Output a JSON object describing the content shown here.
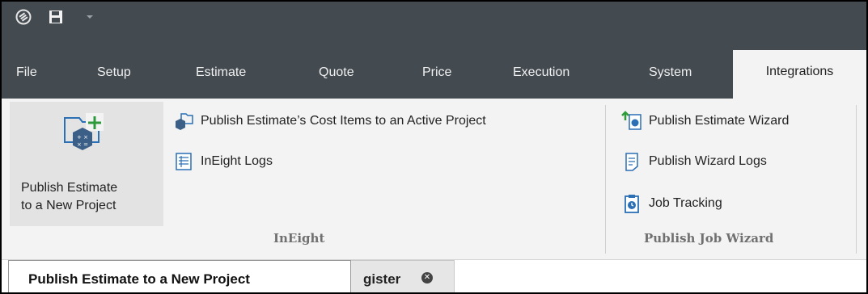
{
  "quick_access": {
    "logo_icon": "app-logo-icon",
    "save_icon": "floppy-disk-icon",
    "dropdown_icon": "chevron-down-icon"
  },
  "menu_tabs": [
    {
      "label": "File"
    },
    {
      "label": "Setup"
    },
    {
      "label": "Estimate"
    },
    {
      "label": "Quote"
    },
    {
      "label": "Price"
    },
    {
      "label": "Execution"
    },
    {
      "label": "System"
    },
    {
      "label": "Integrations",
      "active": true
    }
  ],
  "ribbon": {
    "ineight_group": {
      "label": "InEight",
      "big_button": {
        "label_line1": "Publish Estimate",
        "label_line2": "to a New Project",
        "icon": "new-project-icon"
      },
      "commands": [
        {
          "label": "Publish Estimate’s Cost Items to an Active Project",
          "icon": "publish-active-icon"
        },
        {
          "label": "InEight Logs",
          "icon": "logs-icon"
        }
      ]
    },
    "job_wizard_group": {
      "label": "Publish Job Wizard",
      "commands": [
        {
          "label": "Publish Estimate Wizard",
          "icon": "wizard-icon"
        },
        {
          "label": "Publish Wizard Logs",
          "icon": "document-icon"
        },
        {
          "label": "Job Tracking",
          "icon": "clipboard-icon"
        }
      ]
    }
  },
  "document_tab": {
    "label": "gister",
    "close_icon": "close-icon"
  },
  "tooltip": {
    "text": "Publish Estimate to a New Project"
  },
  "colors": {
    "title_bar": "#434a50",
    "ribbon_bg": "#f3f3f3",
    "accent_green": "#2e9b3b",
    "accent_blue": "#2b6fb5"
  }
}
